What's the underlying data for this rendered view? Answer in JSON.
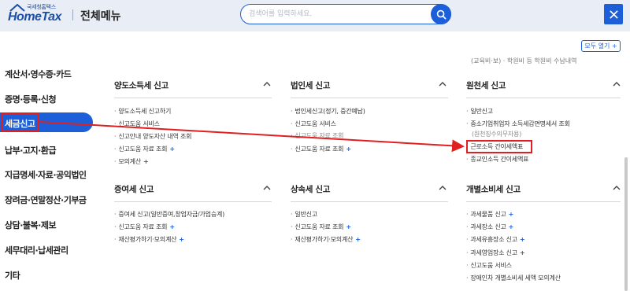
{
  "header": {
    "logo_small": "국세청홈택스",
    "logo_big": "HomeTax",
    "title": "전체메뉴",
    "search_placeholder": "검색어를 입력하세요."
  },
  "open_all": "모두 열기 +",
  "top_cut_text": "(교육비·보) · 학원비 등 학원비 수납내역",
  "sidebar": {
    "items": [
      {
        "label": "계산서·영수증·카드"
      },
      {
        "label": "증명·등록·신청"
      },
      {
        "label": "세금신고"
      },
      {
        "label": "납부·고지·환급"
      },
      {
        "label": "지급명세·자료·공익법인"
      },
      {
        "label": "장려금·연말정산·기부금"
      },
      {
        "label": "상담·불복·제보"
      },
      {
        "label": "세무대리·납세관리"
      },
      {
        "label": "기타"
      }
    ]
  },
  "sections": [
    {
      "title": "양도소득세 신고",
      "items": [
        {
          "label": "양도소득세 신고하기"
        },
        {
          "label": "신고도움 서비스"
        },
        {
          "label": "신고안내 양도자산 내역 조회"
        },
        {
          "label": "신고도움 자료 조회"
        },
        {
          "label": "모의계산"
        }
      ]
    },
    {
      "title": "법인세 신고",
      "items": [
        {
          "label": "법인세신고(정기, 중간예납)"
        },
        {
          "label": "신고도움 서비스"
        },
        {
          "label": "신고도움 자료 조회"
        },
        {
          "label": "신고도움 자료 조회"
        }
      ]
    },
    {
      "title": "원천세 신고",
      "items": [
        {
          "label": "일반신고"
        },
        {
          "label": "중소기업취업자 소득세감면명세서 조회"
        },
        {
          "label": "(원천징수의무자용)"
        },
        {
          "label": "근로소득 간이세액표"
        },
        {
          "label": "종교인소득 간이세액표"
        }
      ]
    },
    {
      "title": "증여세 신고",
      "items": [
        {
          "label": "증여세 신고(일반증여,창업자금/가업승계)"
        },
        {
          "label": "신고도움 자료 조회"
        },
        {
          "label": "재산평가하기·모의계산"
        }
      ]
    },
    {
      "title": "상속세 신고",
      "items": [
        {
          "label": "일반신고"
        },
        {
          "label": "신고도움 자료 조회"
        },
        {
          "label": "재산평가하기·모의계산"
        }
      ]
    },
    {
      "title": "개별소비세 신고",
      "items": [
        {
          "label": "과세물품 신고"
        },
        {
          "label": "과세장소 신고"
        },
        {
          "label": "과세유흥장소 신고"
        },
        {
          "label": "과세영업장소 신고"
        },
        {
          "label": "신고도움 서비스"
        },
        {
          "label": "장애인차 개별소비세 세액 모의계산"
        }
      ]
    }
  ],
  "colors": {
    "brand": "#1d5fd8",
    "header_bg": "#e9edf5",
    "annotation": "#e02020"
  }
}
